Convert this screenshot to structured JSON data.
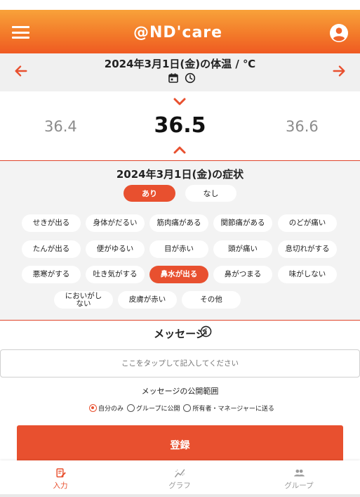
{
  "header": {
    "logo_text": "@ND'care",
    "menu_icon": "hamburger-icon",
    "account_icon": "account-circle-icon",
    "brand_color": "#ef5a22"
  },
  "date_bar": {
    "title": "2024年3月1日(金)の体温 / ℃",
    "prev_icon": "arrow-left-icon",
    "next_icon": "arrow-right-icon",
    "calendar_icon": "calendar-icon",
    "clock_icon": "clock-icon"
  },
  "temperature": {
    "prev": "36.4",
    "current": "36.5",
    "next": "36.6"
  },
  "symptoms": {
    "title": "2024年3月1日(金)の症状",
    "toggle_yes": "あり",
    "toggle_no": "なし",
    "toggle_selected": "あり",
    "items": [
      {
        "label": "せきが出る",
        "selected": false
      },
      {
        "label": "身体がだるい",
        "selected": false
      },
      {
        "label": "筋肉痛がある",
        "selected": false
      },
      {
        "label": "関節痛がある",
        "selected": false
      },
      {
        "label": "のどが痛い",
        "selected": false
      },
      {
        "label": "たんが出る",
        "selected": false
      },
      {
        "label": "便がゆるい",
        "selected": false
      },
      {
        "label": "目が赤い",
        "selected": false
      },
      {
        "label": "頭が痛い",
        "selected": false
      },
      {
        "label": "息切れがする",
        "selected": false
      },
      {
        "label": "悪寒がする",
        "selected": false
      },
      {
        "label": "吐き気がする",
        "selected": false
      },
      {
        "label": "鼻水が出る",
        "selected": true
      },
      {
        "label": "鼻がつまる",
        "selected": false
      },
      {
        "label": "味がしない",
        "selected": false
      },
      {
        "label": "においがしない",
        "selected": false
      },
      {
        "label": "皮膚が赤い",
        "selected": false
      },
      {
        "label": "その他",
        "selected": false
      }
    ]
  },
  "message": {
    "title": "メッセージ",
    "info_icon": "info-icon",
    "placeholder": "ここをタップして記入してください",
    "scope_label": "メッセージの公開範囲",
    "scope_options": [
      "自分のみ",
      "グループに公開",
      "所有者・マネージャーに送る"
    ],
    "scope_selected": "自分のみ",
    "submit_label": "登録"
  },
  "bottom_nav": {
    "items": [
      {
        "label": "入力",
        "icon": "edit-note-icon",
        "active": true
      },
      {
        "label": "グラフ",
        "icon": "line-chart-icon",
        "active": false
      },
      {
        "label": "グループ",
        "icon": "group-icon",
        "active": false
      }
    ]
  }
}
